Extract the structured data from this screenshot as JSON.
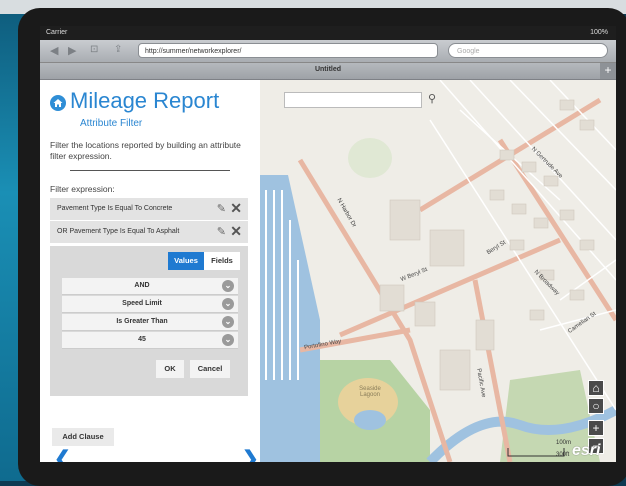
{
  "status": {
    "carrier": "Carrier",
    "battery": "100%"
  },
  "browser": {
    "url": "http://summer/networkexplorer/",
    "search_placeholder": "Google",
    "tab_title": "Untitled",
    "new_tab": "+"
  },
  "panel": {
    "title": "Mileage Report",
    "subtitle": "Attribute Filter",
    "description": "Filter the locations reported by building an attribute filter expression.",
    "filter_label": "Filter expression:",
    "clauses": [
      "Pavement Type Is Equal To Concrete",
      "OR Pavement Type Is Equal To Asphalt"
    ],
    "toggle": {
      "values": "Values",
      "fields": "Fields"
    },
    "selects": [
      "AND",
      "Speed Limit",
      "Is Greater Than",
      "45"
    ],
    "ok": "OK",
    "cancel": "Cancel",
    "add_clause": "Add Clause"
  },
  "map": {
    "streets": [
      "N Harbor Dr",
      "W Beryl St",
      "Beryl St",
      "N Broadway",
      "N Gertrude Ave",
      "Camelian St",
      "Pacific Ave",
      "Portofino Way",
      "Seaside Lagoon"
    ],
    "scale": {
      "upper": "100m",
      "lower": "300ft"
    },
    "logo": "esri"
  }
}
